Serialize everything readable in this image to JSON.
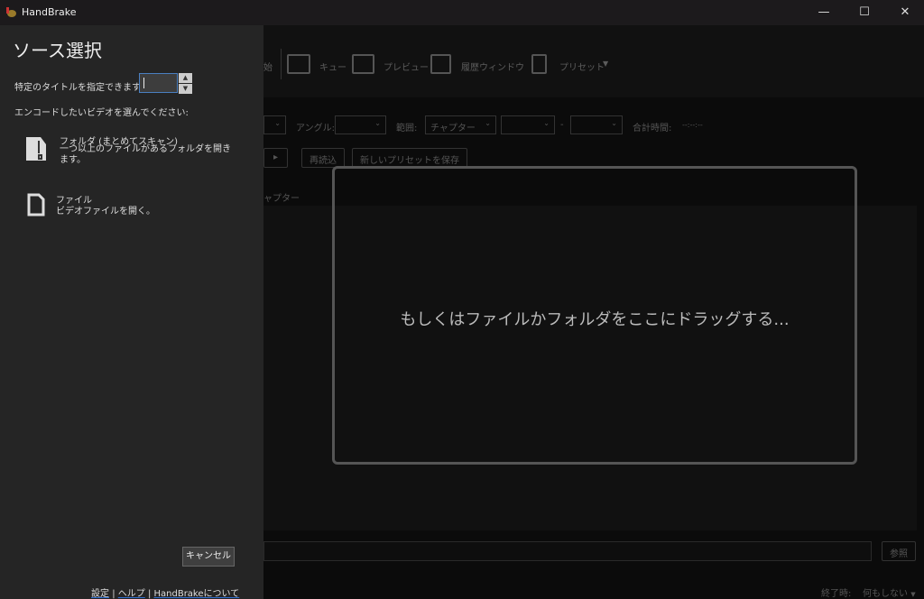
{
  "window": {
    "title": "HandBrake",
    "minimize": "—",
    "maximize": "☐",
    "close": "✕"
  },
  "toolbar": {
    "start_partial": "始",
    "queue": "キュー",
    "preview": "プレビュー",
    "activity": "履歴ウィンドウ",
    "presets": "プリセット"
  },
  "source": {
    "angle_label": "アングル:",
    "range_label": "範囲:",
    "range_value": "チャプター",
    "dash": "-",
    "duration_label": "合計時間:",
    "duration_value": "--:--:--"
  },
  "buttons": {
    "reload": "再読込",
    "save_preset": "新しいプリセットを保存",
    "browse": "参照"
  },
  "tabs": {
    "chapters_partial": "ャプター"
  },
  "drop_zone": {
    "text": "もしくはファイルかフォルダをここにドラッグする..."
  },
  "status": {
    "when_done_label": "終了時:",
    "when_done_value": "何もしない"
  },
  "sidebar": {
    "title": "ソース選択",
    "title_spec_label": "特定のタイトルを指定できます:",
    "title_value": "",
    "prompt": "エンコードしたいビデオを選んでください:",
    "folder": {
      "title": "フォルダ (まとめてスキャン)",
      "desc": "一つ以上のファイルがあるフォルダを開きます。"
    },
    "file": {
      "title": "ファイル",
      "desc": "ビデオファイルを開く。"
    },
    "cancel": "キャンセル",
    "links": {
      "settings": "設定",
      "help": "ヘルプ",
      "about": "HandBrakeについて",
      "sep": "|"
    }
  }
}
